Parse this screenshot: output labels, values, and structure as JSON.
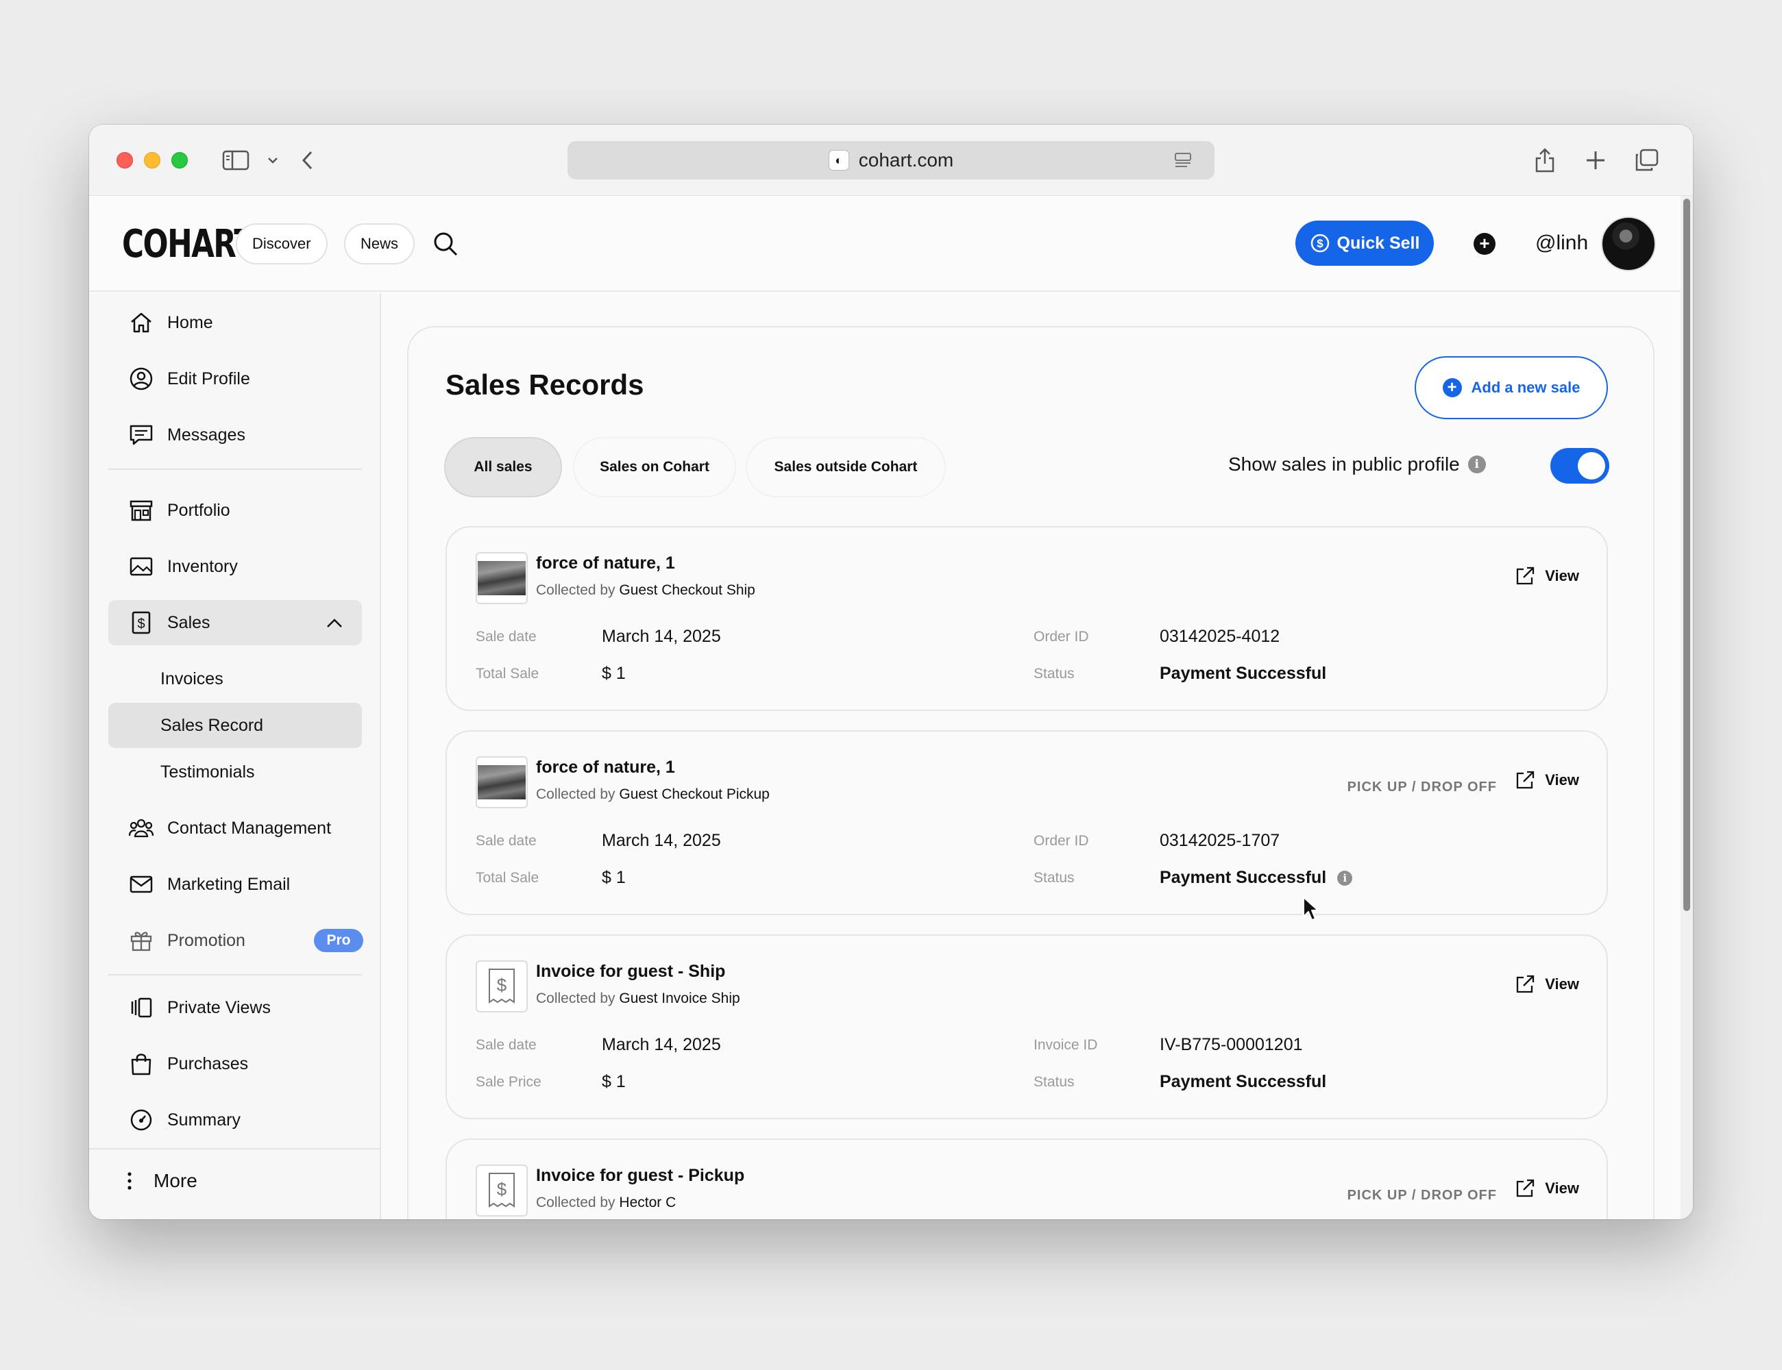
{
  "browser": {
    "url": "cohart.com"
  },
  "topbar": {
    "logo": "COHART",
    "discover": "Discover",
    "news": "News",
    "quick_sell": "Quick Sell",
    "handle": "@linh"
  },
  "sidebar": {
    "home": "Home",
    "edit_profile": "Edit Profile",
    "messages": "Messages",
    "portfolio": "Portfolio",
    "inventory": "Inventory",
    "sales": "Sales",
    "invoices": "Invoices",
    "sales_record": "Sales Record",
    "testimonials": "Testimonials",
    "contact_management": "Contact Management",
    "marketing_email": "Marketing Email",
    "promotion": "Promotion",
    "pro_badge": "Pro",
    "private_views": "Private Views",
    "purchases": "Purchases",
    "summary": "Summary",
    "more": "More"
  },
  "main": {
    "title": "Sales Records",
    "add_sale": "Add a new sale",
    "tabs": [
      "All sales",
      "Sales on Cohart",
      "Sales outside Cohart"
    ],
    "show_sales_label": "Show sales in public profile",
    "toggle_on": true,
    "accent_color": "#1565e8"
  },
  "records": [
    {
      "title": "force of nature, 1",
      "collected_prefix": "Collected by",
      "collected_by": "Guest Checkout Ship",
      "tag": "",
      "view": "View",
      "label_date": "Sale date",
      "date": "March 14, 2025",
      "label_total": "Total Sale",
      "total": "$ 1",
      "label_id": "Order ID",
      "id": "03142025-4012",
      "label_status": "Status",
      "status": "Payment Successful"
    },
    {
      "title": "force of nature, 1",
      "collected_prefix": "Collected by",
      "collected_by": "Guest Checkout Pickup",
      "tag": "PICK UP / DROP OFF",
      "view": "View",
      "label_date": "Sale date",
      "date": "March 14, 2025",
      "label_total": "Total Sale",
      "total": "$ 1",
      "label_id": "Order ID",
      "id": "03142025-1707",
      "label_status": "Status",
      "status": "Payment Successful"
    },
    {
      "title": "Invoice for guest - Ship",
      "collected_prefix": "Collected by",
      "collected_by": "Guest Invoice Ship",
      "tag": "",
      "view": "View",
      "label_date": "Sale date",
      "date": "March 14, 2025",
      "label_total": "Sale Price",
      "total": "$ 1",
      "label_id": "Invoice ID",
      "id": "IV-B775-00001201",
      "label_status": "Status",
      "status": "Payment Successful"
    },
    {
      "title": "Invoice for guest - Pickup",
      "collected_prefix": "Collected by",
      "collected_by": "Hector C",
      "tag": "PICK UP / DROP OFF",
      "view": "View"
    }
  ]
}
